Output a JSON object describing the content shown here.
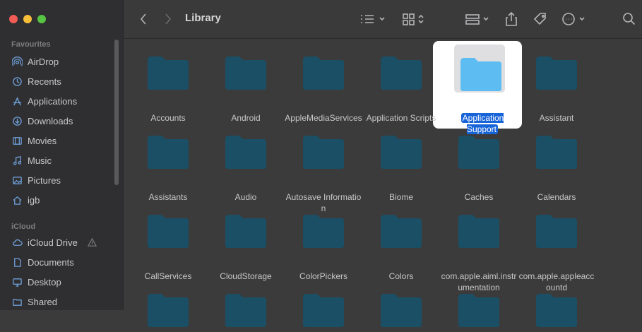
{
  "window": {
    "title": "Library"
  },
  "sidebar": {
    "sections": [
      {
        "heading": "Favourites",
        "items": [
          {
            "label": "AirDrop",
            "icon": "airdrop-icon"
          },
          {
            "label": "Recents",
            "icon": "clock-icon"
          },
          {
            "label": "Applications",
            "icon": "applications-icon"
          },
          {
            "label": "Downloads",
            "icon": "download-icon"
          },
          {
            "label": "Movies",
            "icon": "film-icon"
          },
          {
            "label": "Music",
            "icon": "music-icon"
          },
          {
            "label": "Pictures",
            "icon": "photo-icon"
          },
          {
            "label": "igb",
            "icon": "home-icon"
          }
        ]
      },
      {
        "heading": "iCloud",
        "items": [
          {
            "label": "iCloud Drive",
            "icon": "cloud-icon"
          },
          {
            "label": "Documents",
            "icon": "document-icon"
          },
          {
            "label": "Desktop",
            "icon": "desktop-icon"
          },
          {
            "label": "Shared",
            "icon": "shared-folder-icon"
          }
        ]
      }
    ]
  },
  "folders": [
    "Accounts",
    "Android",
    "AppleMediaServices",
    "Application Scripts",
    "Application Support",
    "Assistant",
    "Assistants",
    "Audio",
    "Autosave Information",
    "Biome",
    "Caches",
    "Calendars",
    "CallServices",
    "CloudStorage",
    "ColorPickers",
    "Colors",
    "com.apple.aiml.instrumentation",
    "com.apple.appleaccountd"
  ],
  "selected_folder": "Application Support",
  "colors": {
    "folder": "#1b4f66",
    "folder_selected": "#5dbcf2",
    "selection": "#1763d8"
  }
}
